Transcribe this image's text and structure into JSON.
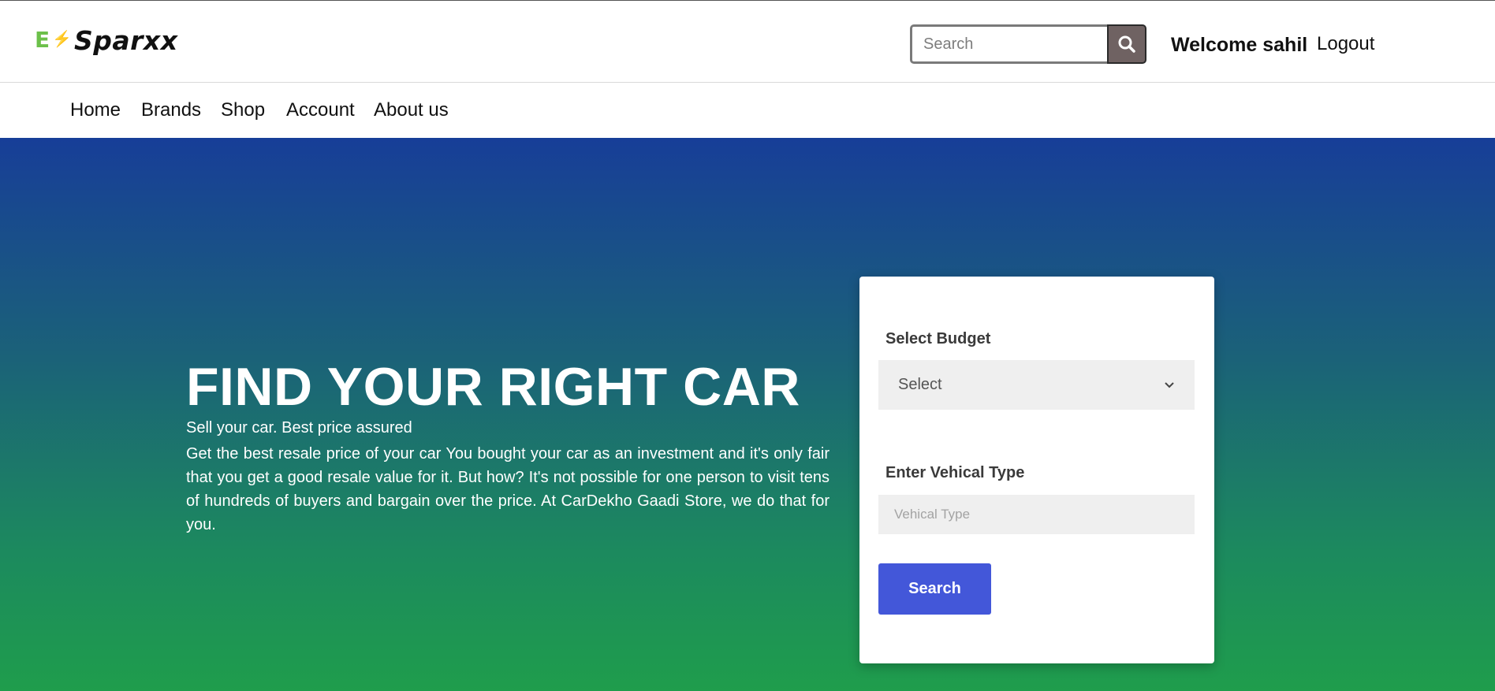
{
  "header": {
    "brand": "Sparxx",
    "search": {
      "placeholder": "Search",
      "value": ""
    },
    "welcome_text": "Welcome sahil",
    "logout_label": "Logout"
  },
  "nav": {
    "items": [
      {
        "label": "Home"
      },
      {
        "label": "Brands"
      },
      {
        "label": "Shop"
      },
      {
        "label": "Account"
      },
      {
        "label": "About us"
      }
    ]
  },
  "hero": {
    "title": "FIND YOUR RIGHT CAR",
    "subtitle": "Sell your car. Best price assured",
    "body": "Get the best resale price of your car You bought your car as an investment and it's only fair that you get a good resale value for it. But how? It's not possible for one person to visit tens of hundreds of buyers and bargain over the price. At CarDekho Gaadi Store, we do that for you."
  },
  "finder": {
    "budget_label": "Select Budget",
    "budget_selected": "Select",
    "type_label": "Enter Vehical Type",
    "type_placeholder": "Vehical Type",
    "search_label": "Search"
  },
  "colors": {
    "logo_green": "#6cc04a",
    "search_button": "#6f6262",
    "hero_top": "#173e98",
    "hero_bottom": "#1f9d4c",
    "primary_button": "#4357d9"
  },
  "icons": {
    "search_button_icon": "search-icon",
    "select_arrow": "chevron-down-icon",
    "logo": "logo-icon"
  }
}
